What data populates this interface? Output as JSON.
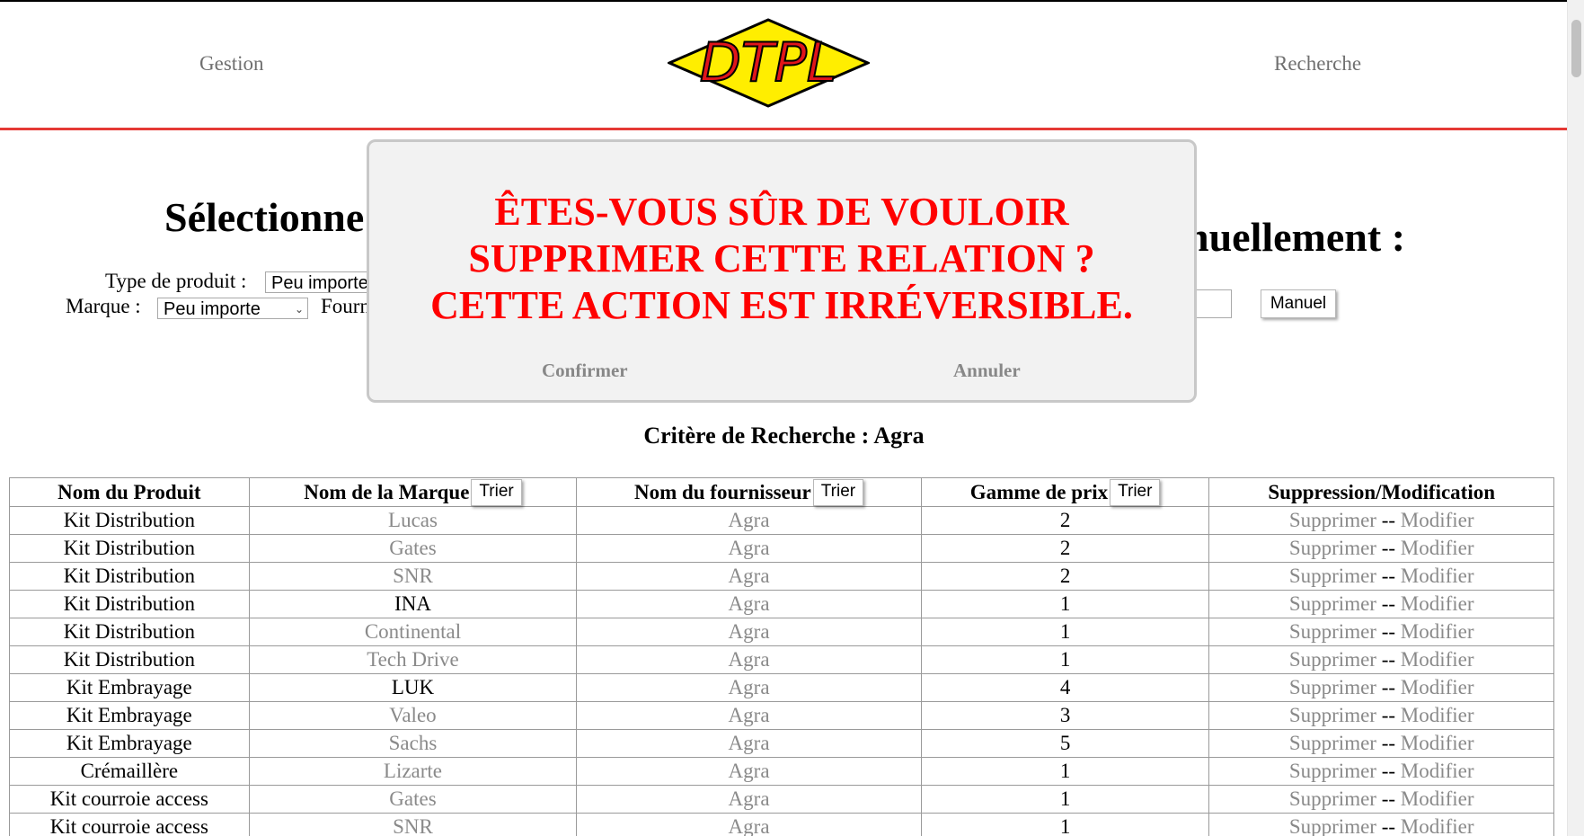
{
  "header": {
    "nav_left": "Gestion",
    "nav_right": "Recherche",
    "logo_text": "DTPL"
  },
  "selection": {
    "title_left": "Sélectionne",
    "title_right": "nuellement :",
    "type_label": "Type de produit :",
    "type_value": "Peu importe",
    "marque_label": "Marque :",
    "marque_value": "Peu importe",
    "fournisseur_label": "Fourn",
    "manual_button": "Manuel"
  },
  "modal": {
    "line1": "ÊTES-VOUS SÛR DE VOULOIR",
    "line2": "SUPPRIMER CETTE RELATION ?",
    "line3": "CETTE ACTION EST IRRÉVERSIBLE.",
    "confirm": "Confirmer",
    "cancel": "Annuler",
    "message_color": "#ff0000"
  },
  "criteria": "Critère de Recherche : Agra",
  "table": {
    "headers": {
      "produit": "Nom du Produit",
      "marque": "Nom de la Marque",
      "fournisseur": "Nom du fournisseur",
      "gamme": "Gamme de prix",
      "actions": "Suppression/Modification"
    },
    "sort_label": "Trier",
    "delete_label": "Supprimer",
    "separator": "--",
    "edit_label": "Modifier",
    "rows": [
      {
        "produit": "Kit Distribution",
        "marque": "Lucas",
        "marque_dark": false,
        "fournisseur": "Agra",
        "gamme": "2"
      },
      {
        "produit": "Kit Distribution",
        "marque": "Gates",
        "marque_dark": false,
        "fournisseur": "Agra",
        "gamme": "2"
      },
      {
        "produit": "Kit Distribution",
        "marque": "SNR",
        "marque_dark": false,
        "fournisseur": "Agra",
        "gamme": "2"
      },
      {
        "produit": "Kit Distribution",
        "marque": "INA",
        "marque_dark": true,
        "fournisseur": "Agra",
        "gamme": "1"
      },
      {
        "produit": "Kit Distribution",
        "marque": "Continental",
        "marque_dark": false,
        "fournisseur": "Agra",
        "gamme": "1"
      },
      {
        "produit": "Kit Distribution",
        "marque": "Tech Drive",
        "marque_dark": false,
        "fournisseur": "Agra",
        "gamme": "1"
      },
      {
        "produit": "Kit Embrayage",
        "marque": "LUK",
        "marque_dark": true,
        "fournisseur": "Agra",
        "gamme": "4"
      },
      {
        "produit": "Kit Embrayage",
        "marque": "Valeo",
        "marque_dark": false,
        "fournisseur": "Agra",
        "gamme": "3"
      },
      {
        "produit": "Kit Embrayage",
        "marque": "Sachs",
        "marque_dark": false,
        "fournisseur": "Agra",
        "gamme": "5"
      },
      {
        "produit": "Crémaillère",
        "marque": "Lizarte",
        "marque_dark": false,
        "fournisseur": "Agra",
        "gamme": "1"
      },
      {
        "produit": "Kit courroie access",
        "marque": "Gates",
        "marque_dark": false,
        "fournisseur": "Agra",
        "gamme": "1"
      },
      {
        "produit": "Kit courroie access",
        "marque": "SNR",
        "marque_dark": false,
        "fournisseur": "Agra",
        "gamme": "1"
      }
    ]
  }
}
